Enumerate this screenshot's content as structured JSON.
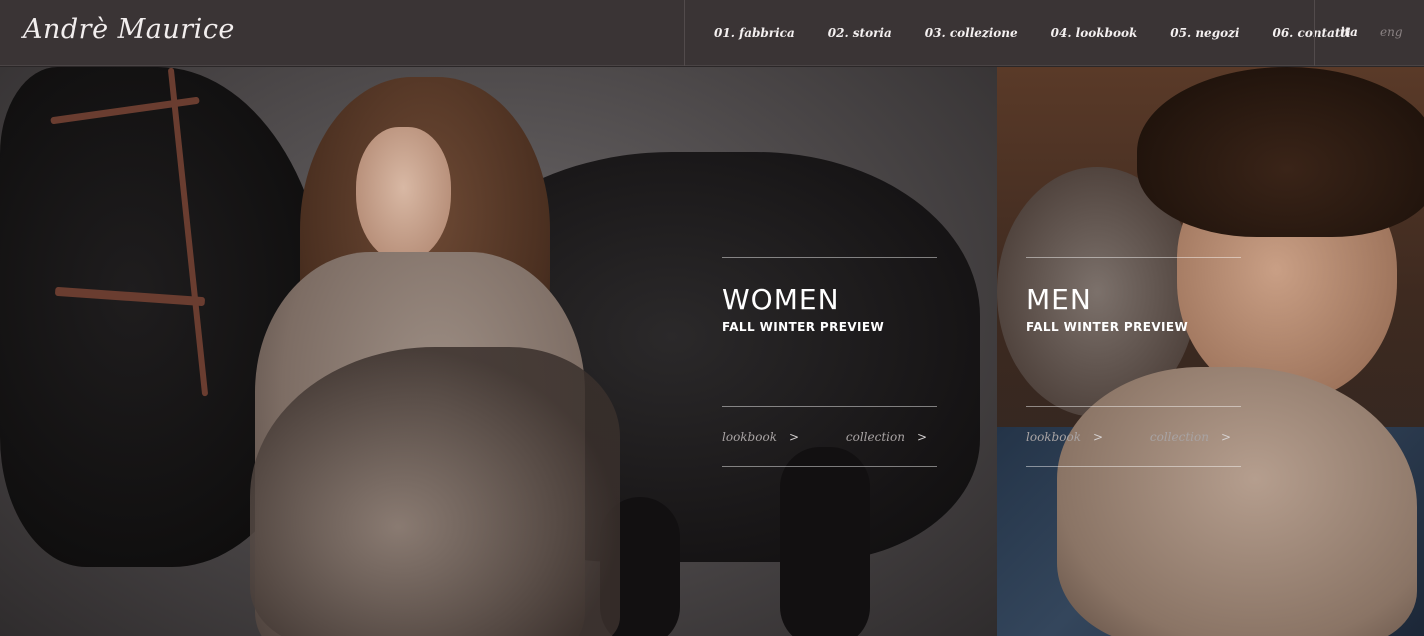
{
  "header": {
    "logo": "Andrè Maurice",
    "nav": [
      "01. fabbrica",
      "02. storia",
      "03. collezione",
      "04. lookbook",
      "05. negozi",
      "06. contatti"
    ],
    "lang_active": "ita",
    "lang_inactive": "eng"
  },
  "women": {
    "title": "WOMEN",
    "subtitle": "FALL WINTER PREVIEW",
    "lookbook": "lookbook",
    "collection": "collection",
    "chevron": ">"
  },
  "men": {
    "title": "MEN",
    "subtitle": "FALL WINTER PREVIEW",
    "lookbook": "lookbook",
    "collection": "collection",
    "chevron": ">"
  },
  "colors": {
    "header_bg": "#3a3435",
    "text": "#ffffff",
    "link": "#a8a3a3",
    "lang_inactive": "#8a8283"
  }
}
